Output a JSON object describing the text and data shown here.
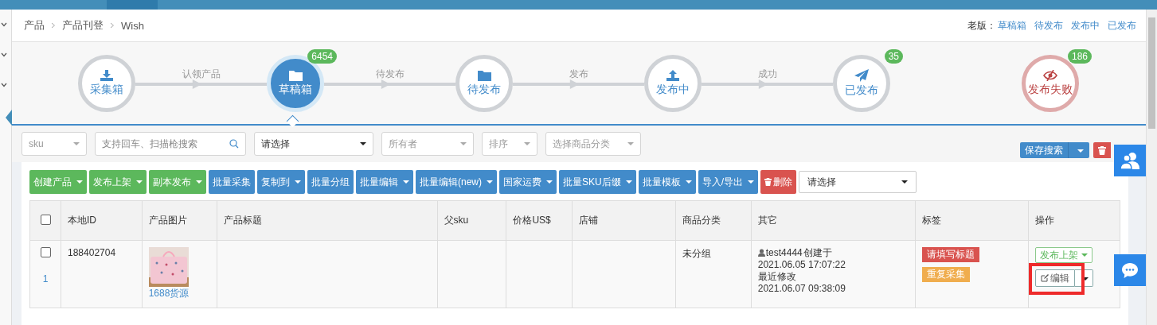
{
  "breadcrumb": [
    "产品",
    "产品刊登",
    "Wish"
  ],
  "old_version": {
    "label": "老版：",
    "links": [
      "草稿箱",
      "待发布",
      "发布中",
      "已发布"
    ]
  },
  "steps": [
    {
      "label": "采集箱",
      "selected": false,
      "kind": "collect"
    },
    {
      "label": "草稿箱",
      "count": "6454",
      "selected": true,
      "kind": "draft"
    },
    {
      "label": "待发布",
      "selected": false,
      "kind": "draft"
    },
    {
      "label": "发布中",
      "selected": false,
      "kind": "publishing"
    },
    {
      "label": "已发布",
      "count": "35",
      "selected": false,
      "kind": "published"
    },
    {
      "label": "发布失败",
      "count": "186",
      "selected": false,
      "kind": "failed"
    }
  ],
  "connectors": [
    "认领产品",
    "待发布",
    "发布",
    "成功"
  ],
  "filters": [
    {
      "kind": "select",
      "placeholder": "sku"
    },
    {
      "kind": "search",
      "placeholder": "支持回车、扫描枪搜索"
    },
    {
      "kind": "select",
      "value": "请选择"
    },
    {
      "kind": "select",
      "placeholder": "所有者"
    },
    {
      "kind": "select",
      "placeholder": "排序"
    },
    {
      "kind": "select",
      "placeholder": "选择商品分类"
    }
  ],
  "save_search": {
    "label": "保存搜索"
  },
  "toolbar": [
    {
      "label": "创建产品",
      "color": "#5cb85c",
      "dropdown": true
    },
    {
      "label": "发布上架",
      "color": "#5cb85c",
      "dropdown": true
    },
    {
      "label": "副本发布",
      "color": "#5cb85c",
      "dropdown": true
    },
    {
      "label": "批量采集",
      "color": "#428bca",
      "dropdown": false
    },
    {
      "label": "复制到",
      "color": "#428bca",
      "dropdown": true
    },
    {
      "label": "批量分组",
      "color": "#428bca",
      "dropdown": false
    },
    {
      "label": "批量编辑",
      "color": "#428bca",
      "dropdown": true
    },
    {
      "label": "批量编辑(new)",
      "color": "#428bca",
      "dropdown": true
    },
    {
      "label": "国家运费",
      "color": "#428bca",
      "dropdown": true
    },
    {
      "label": "批量SKU后缀",
      "color": "#428bca",
      "dropdown": true
    },
    {
      "label": "批量模板",
      "color": "#428bca",
      "dropdown": true
    },
    {
      "label": "导入/导出",
      "color": "#428bca",
      "dropdown": true
    },
    {
      "label": "删除",
      "color": "#d9534f",
      "dropdown": false,
      "kind": "delete"
    }
  ],
  "toolbar_select": {
    "value": "请选择"
  },
  "table": {
    "header_checked": false,
    "columns": [
      "本地ID",
      "产品图片",
      "产品标题",
      "父sku",
      "价格US$",
      "店铺",
      "商品分类",
      "其它",
      "标签",
      "操作"
    ],
    "rows": [
      {
        "checked": false,
        "index": "1",
        "id": "188402704",
        "image": {
          "kind": "picture"
        },
        "source": "1688货源",
        "category": "未分组",
        "creator": "test4444",
        "created_label": "创建于",
        "created": "2021.06.05 17:07:22",
        "modified_label": "最近修改",
        "modified": "2021.06.07 09:38:09",
        "tags": [
          {
            "label": "请填写标题",
            "color": "#d9534f"
          },
          {
            "label": "重复采集",
            "color": "#f0ad4e"
          }
        ],
        "publish": "发布上架",
        "edit": "编辑"
      }
    ]
  }
}
